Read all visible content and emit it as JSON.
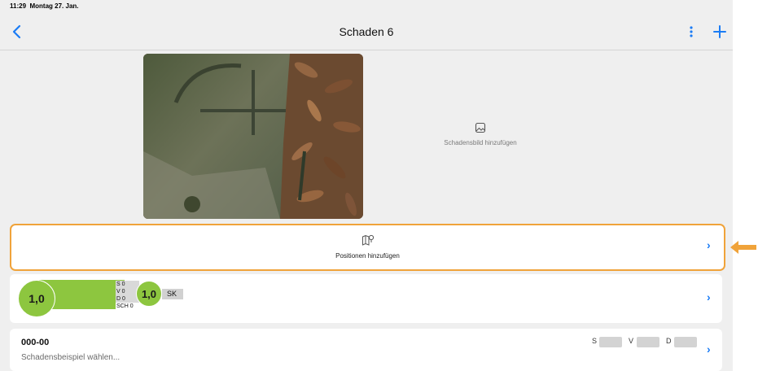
{
  "statusbar": {
    "time": "11:29",
    "date": "Montag 27. Jan."
  },
  "navbar": {
    "title": "Schaden 6",
    "back_icon": "chevron-left-icon",
    "more_icon": "more-vertical-icon",
    "add_icon": "plus-icon",
    "accent": "#1b7cf5"
  },
  "photos": {
    "add_label": "Schadensbild hinzufügen",
    "add_icon": "image-icon"
  },
  "positions": {
    "label": "Positionen hinzufügen",
    "icon": "map-pin-icon",
    "highlight_color": "#f0a33a"
  },
  "rating": {
    "overall": "1,0",
    "secondary": "1,0",
    "rows": [
      "S 0",
      "V 0",
      "D 0",
      "SCH 0"
    ],
    "sk_label": "SK",
    "bar_color": "#8dc63f"
  },
  "sample": {
    "code": "000-00",
    "placeholder": "Schadensbeispiel wählen...",
    "s_label": "S",
    "v_label": "V",
    "d_label": "D"
  }
}
